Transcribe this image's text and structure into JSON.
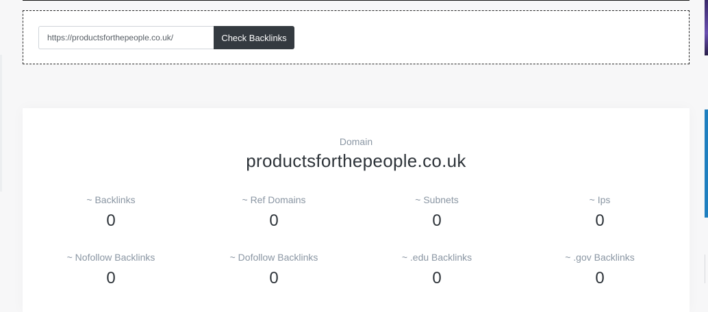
{
  "search": {
    "url_value": "https://productsforthepeople.co.uk/",
    "button_label": "Check Backlinks"
  },
  "result": {
    "domain_label": "Domain",
    "domain_value": "productsforthepeople.co.uk",
    "stats": [
      {
        "label": "~ Backlinks",
        "value": "0"
      },
      {
        "label": "~ Ref Domains",
        "value": "0"
      },
      {
        "label": "~ Subnets",
        "value": "0"
      },
      {
        "label": "~ Ips",
        "value": "0"
      },
      {
        "label": "~ Nofollow Backlinks",
        "value": "0"
      },
      {
        "label": "~ Dofollow Backlinks",
        "value": "0"
      },
      {
        "label": "~ .edu Backlinks",
        "value": "0"
      },
      {
        "label": "~ .gov Backlinks",
        "value": "0"
      }
    ]
  },
  "colors": {
    "button_bg": "#343a40",
    "muted_text": "#8a96a3",
    "value_text": "#2d3339"
  }
}
